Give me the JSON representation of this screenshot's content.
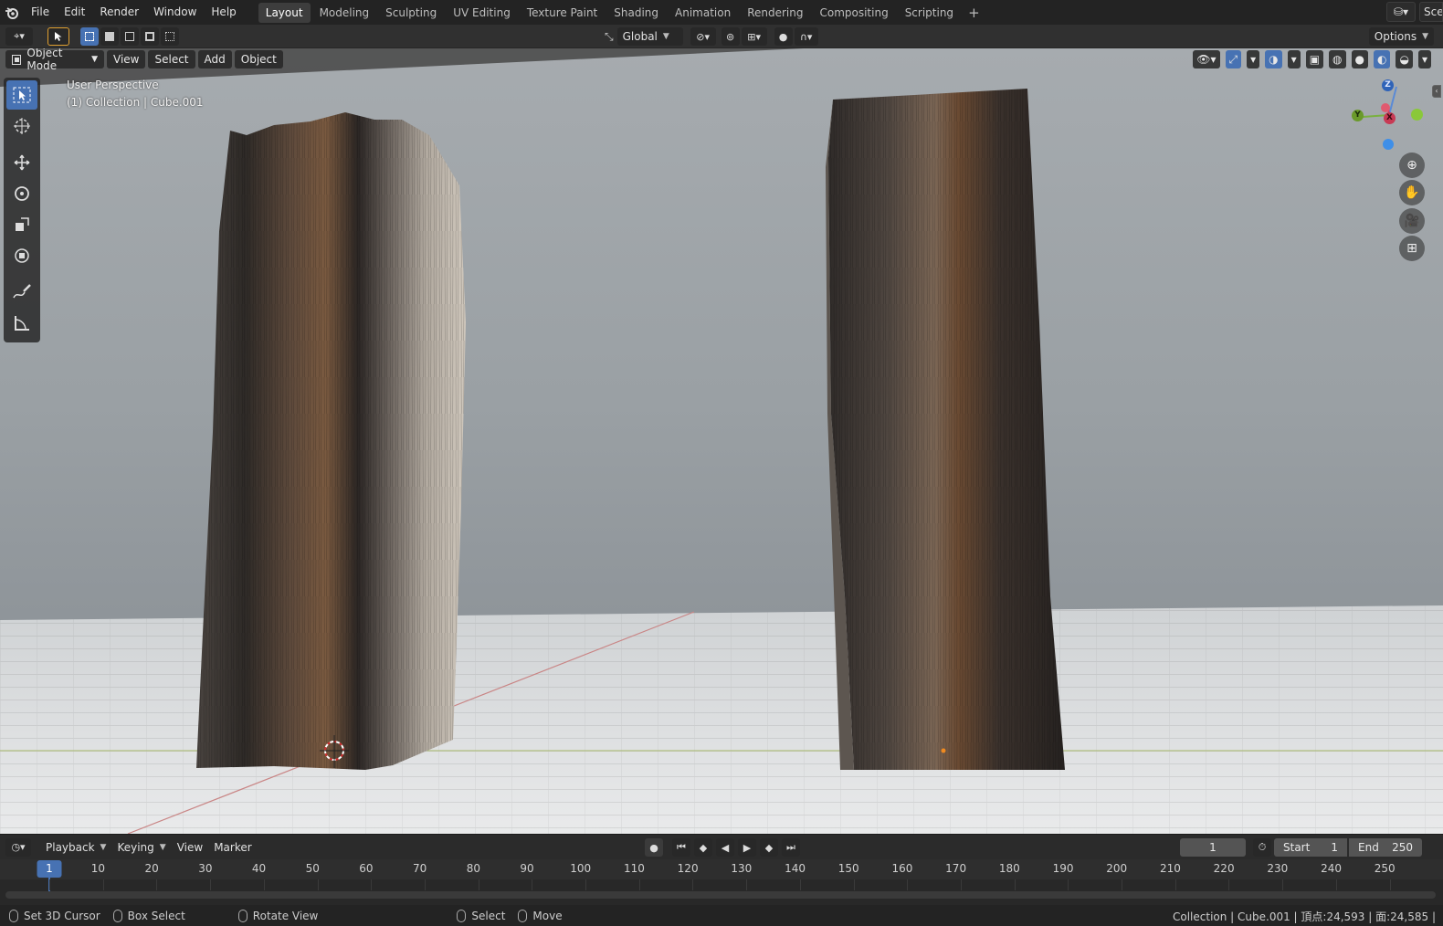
{
  "menu": [
    "File",
    "Edit",
    "Render",
    "Window",
    "Help"
  ],
  "workspaces": [
    {
      "label": "Layout",
      "active": true
    },
    {
      "label": "Modeling"
    },
    {
      "label": "Sculpting"
    },
    {
      "label": "UV Editing"
    },
    {
      "label": "Texture Paint"
    },
    {
      "label": "Shading"
    },
    {
      "label": "Animation"
    },
    {
      "label": "Rendering"
    },
    {
      "label": "Compositing"
    },
    {
      "label": "Scripting"
    }
  ],
  "scene_label": "Scer",
  "toolheader": {
    "orientation": "Global",
    "options": "Options"
  },
  "viewport": {
    "mode": "Object Mode",
    "menus": [
      "View",
      "Select",
      "Add",
      "Object"
    ],
    "perspective": "User Perspective",
    "collection_info": "(1) Collection | Cube.001",
    "gizmo": {
      "x": "X",
      "y": "Y",
      "z": "Z"
    }
  },
  "timeline": {
    "menus": [
      "Playback",
      "Keying",
      "View",
      "Marker"
    ],
    "current_frame": "1",
    "start_label": "Start",
    "start_value": "1",
    "end_label": "End",
    "end_value": "250",
    "ruler_current": "1",
    "ruler_ticks": [
      "10",
      "20",
      "30",
      "40",
      "50",
      "60",
      "70",
      "80",
      "90",
      "100",
      "110",
      "120",
      "130",
      "140",
      "150",
      "160",
      "170",
      "180",
      "190",
      "200",
      "210",
      "220",
      "230",
      "240",
      "250"
    ]
  },
  "status": {
    "set_cursor": "Set 3D Cursor",
    "box_select": "Box Select",
    "rotate_view": "Rotate View",
    "select": "Select",
    "move": "Move",
    "info": "Collection | Cube.001 | 頂点:24,593 | 面:24,585 |"
  }
}
